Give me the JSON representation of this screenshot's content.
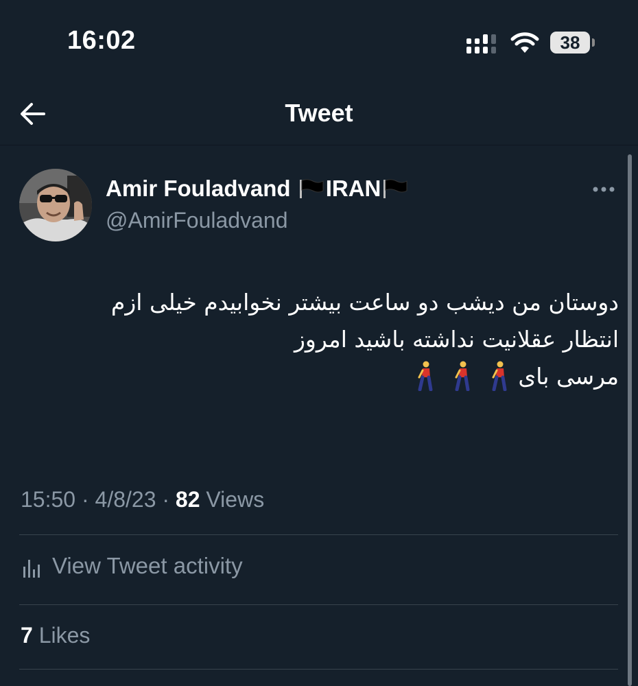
{
  "status_bar": {
    "time": "16:02",
    "battery_level": "38",
    "icons": [
      "cellular-signal-icon",
      "wifi-icon",
      "battery-icon"
    ]
  },
  "header": {
    "title": "Tweet",
    "back_icon": "back-arrow-icon"
  },
  "tweet": {
    "author": {
      "name": "Amir Fouladvand",
      "name_suffix": "IRAN",
      "handle": "@AmirFouladvand",
      "avatar": "profile-photo"
    },
    "text_lines": [
      "دوستان من دیشب دو ساعت بیشتر نخوابیدم خیلی ازم",
      "انتظار عقلانیت نداشته باشید امروز",
      "مرسی بای"
    ],
    "emoji": "person-walking-icon",
    "emoji_count": 3,
    "time": "15:50",
    "date": "4/8/23",
    "views_count": "82",
    "views_label": "Views",
    "separator": "·"
  },
  "actions": {
    "view_activity_label": "View Tweet activity",
    "activity_icon": "analytics-bar-chart-icon",
    "likes_count": "7",
    "likes_label": "Likes",
    "more_icon": "more-options-icon"
  },
  "colors": {
    "background": "#15202b",
    "primary_text": "#ffffff",
    "secondary_text": "#8b98a5",
    "divider": "#38444d"
  }
}
